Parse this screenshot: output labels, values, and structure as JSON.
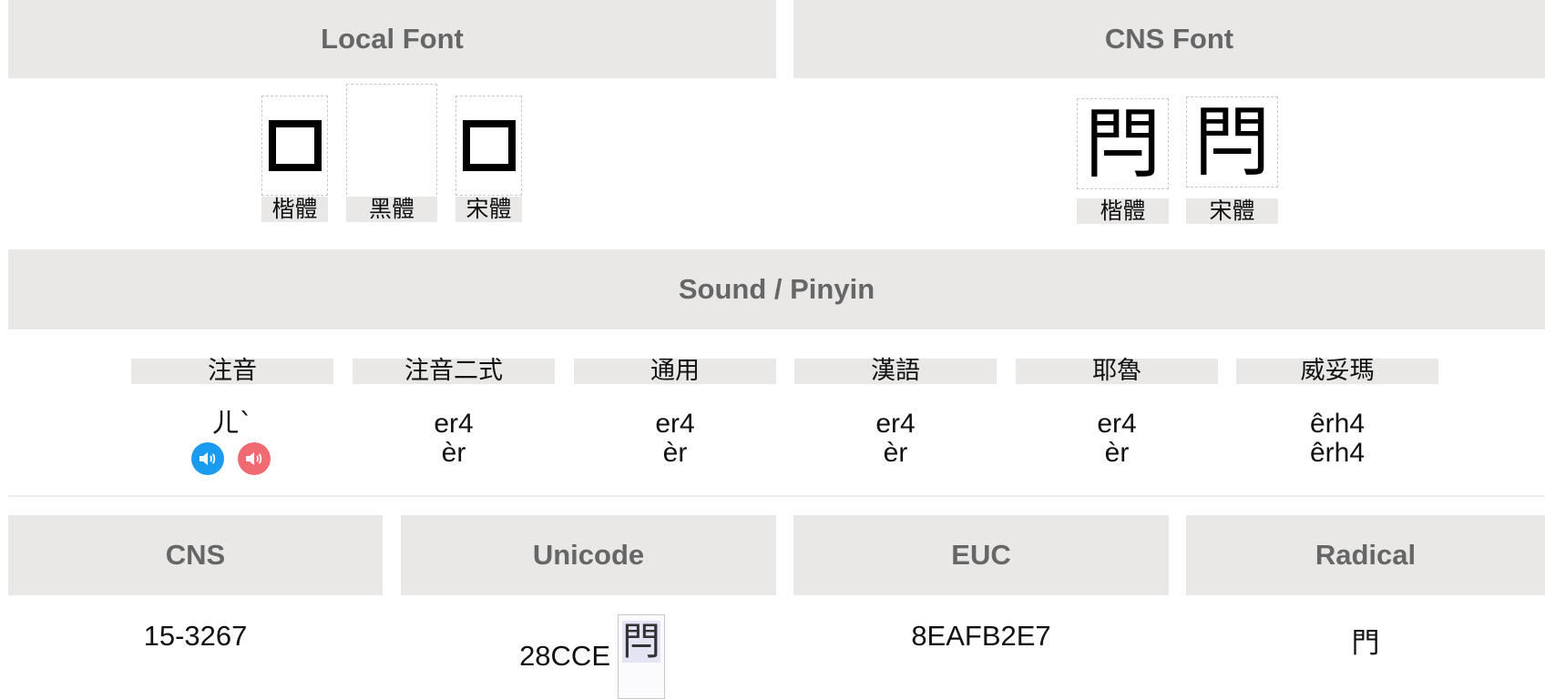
{
  "local_font": {
    "title": "Local Font",
    "fonts": [
      {
        "label": "楷體",
        "state": "missing-glyph"
      },
      {
        "label": "黑體",
        "state": "empty"
      },
      {
        "label": "宋體",
        "state": "missing-glyph"
      }
    ]
  },
  "cns_font": {
    "title": "CNS Font",
    "fonts": [
      {
        "label": "楷體",
        "glyph": "閂"
      },
      {
        "label": "宋體",
        "glyph": "閂"
      }
    ]
  },
  "sound": {
    "title": "Sound / Pinyin",
    "systems": [
      {
        "label": "注音",
        "line1": "ㄦˋ",
        "line2": ""
      },
      {
        "label": "注音二式",
        "line1": "er4",
        "line2": "èr"
      },
      {
        "label": "通用",
        "line1": "er4",
        "line2": "èr"
      },
      {
        "label": "漢語",
        "line1": "er4",
        "line2": "èr"
      },
      {
        "label": "耶魯",
        "line1": "er4",
        "line2": "èr"
      },
      {
        "label": "威妥瑪",
        "line1": "êrh4",
        "line2": "êrh4"
      }
    ],
    "speakers": [
      {
        "icon": "speaker-icon",
        "color": "#1a9bf0"
      },
      {
        "icon": "speaker-icon",
        "color": "#ef6b71"
      }
    ]
  },
  "codes": {
    "cns": {
      "title": "CNS",
      "value": "15-3267"
    },
    "unicode": {
      "title": "Unicode",
      "value": "28CCE",
      "glyph": "閂"
    },
    "euc": {
      "title": "EUC",
      "value": "8EAFB2E7"
    },
    "radical": {
      "title": "Radical",
      "value": "門"
    }
  },
  "colors": {
    "header_bg": "#e9e8e7",
    "header_text": "#666666",
    "speaker_blue": "#1a9bf0",
    "speaker_red": "#ef6b71"
  }
}
